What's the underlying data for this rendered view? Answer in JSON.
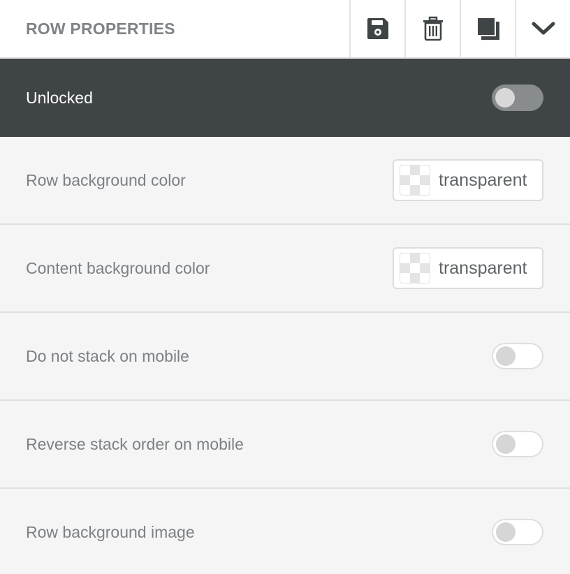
{
  "header": {
    "title": "ROW PROPERTIES",
    "buttons": [
      {
        "icon": "save-icon"
      },
      {
        "icon": "trash-icon"
      },
      {
        "icon": "duplicate-icon"
      },
      {
        "icon": "chevron-down-icon"
      }
    ]
  },
  "lock": {
    "label": "Unlocked",
    "toggle_on": false
  },
  "properties": [
    {
      "label": "Row background color",
      "type": "color",
      "value": "transparent"
    },
    {
      "label": "Content background color",
      "type": "color",
      "value": "transparent"
    },
    {
      "label": "Do not stack on mobile",
      "type": "toggle",
      "on": false
    },
    {
      "label": "Reverse stack order on mobile",
      "type": "toggle",
      "on": false
    },
    {
      "label": "Row background image",
      "type": "toggle",
      "on": false
    }
  ],
  "colors": {
    "header_text": "#7d8387",
    "lock_bar": "#3f4447",
    "row_bg": "#f5f5f5",
    "label_text": "#7b8185"
  }
}
